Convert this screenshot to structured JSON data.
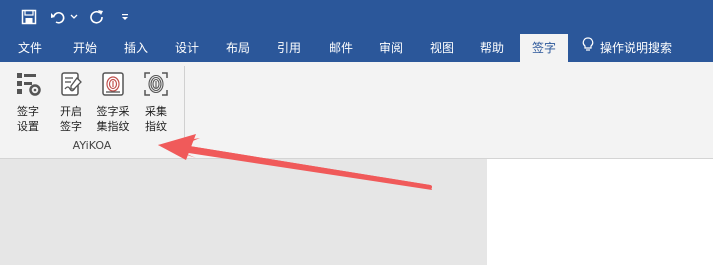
{
  "quick_access": {
    "save_icon": "save-icon",
    "undo_icon": "undo-icon",
    "undo_dropdown_icon": "chevron-down-icon",
    "redo_icon": "redo-icon",
    "customize_icon": "customize-quick-access-icon"
  },
  "tabs": [
    {
      "label": "文件"
    },
    {
      "label": "开始"
    },
    {
      "label": "插入"
    },
    {
      "label": "设计"
    },
    {
      "label": "布局"
    },
    {
      "label": "引用"
    },
    {
      "label": "邮件"
    },
    {
      "label": "审阅"
    },
    {
      "label": "视图"
    },
    {
      "label": "帮助"
    },
    {
      "label": "签字",
      "active": true
    }
  ],
  "tell_me": {
    "label": "操作说明搜索",
    "icon": "lightbulb-icon"
  },
  "ribbon": {
    "buttons": [
      {
        "label": "签字\n设置",
        "icon": "signature-settings-icon"
      },
      {
        "label": "开启\n签字",
        "icon": "enable-signature-icon"
      },
      {
        "label": "签字采\n集指纹",
        "icon": "signature-fingerprint-icon"
      },
      {
        "label": "采集\n指纹",
        "icon": "fingerprint-icon"
      }
    ],
    "group_label": "AYiKOA"
  },
  "colors": {
    "accent": "#2b579a",
    "annotation_arrow": "#f05a5a"
  }
}
